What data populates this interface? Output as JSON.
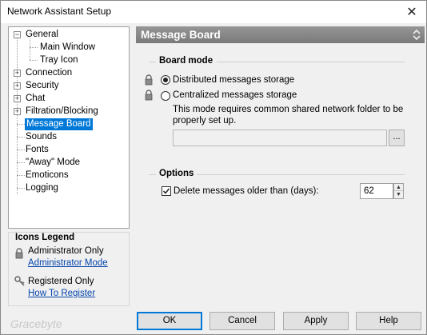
{
  "window": {
    "title": "Network Assistant Setup"
  },
  "tree": {
    "items": [
      {
        "label": "General",
        "expander": "−"
      },
      {
        "label": "Main Window"
      },
      {
        "label": "Tray Icon"
      },
      {
        "label": "Connection",
        "expander": "+"
      },
      {
        "label": "Security",
        "expander": "+"
      },
      {
        "label": "Chat",
        "expander": "+"
      },
      {
        "label": "Filtration/Blocking",
        "expander": "+"
      },
      {
        "label": "Message Board"
      },
      {
        "label": "Sounds"
      },
      {
        "label": "Fonts"
      },
      {
        "label": "\"Away\" Mode"
      },
      {
        "label": "Emoticons"
      },
      {
        "label": "Logging"
      }
    ]
  },
  "legend": {
    "title": "Icons Legend",
    "admin_label": "Administrator Only",
    "admin_link": "Administrator Mode",
    "registered_label": "Registered Only",
    "registered_link": "How To Register"
  },
  "panel": {
    "title": "Message Board",
    "board_mode": {
      "heading": "Board mode",
      "distributed": "Distributed messages storage",
      "centralized": "Centralized messages storage",
      "note_line1": "This mode requires common shared network folder to be",
      "note_line2": "properly set up.",
      "browse": "...",
      "path_value": ""
    },
    "options": {
      "heading": "Options",
      "delete_label": "Delete messages older than (days):",
      "days_value": "62"
    }
  },
  "buttons": {
    "ok": "OK",
    "cancel": "Cancel",
    "apply": "Apply",
    "help": "Help"
  },
  "watermark": "Gracebyte"
}
